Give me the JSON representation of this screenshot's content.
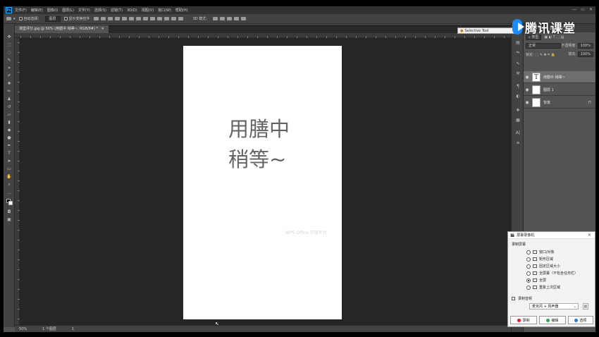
{
  "menubar": {
    "logo": "Ps",
    "items": [
      "文件(F)",
      "编辑(E)",
      "图像(I)",
      "图层(L)",
      "文字(Y)",
      "选择(S)",
      "滤镜(T)",
      "3D(D)",
      "视图(V)",
      "窗口(W)",
      "帮助(H)"
    ],
    "controls": [
      "—",
      "▭",
      "✕"
    ]
  },
  "optbar": {
    "auto_select": "自动选择：",
    "auto_select_value": "图层",
    "show_transform": "显示变换控件",
    "mode_3d": "3D 模式："
  },
  "document": {
    "tab_title": "课堂评分.jpg @ 50% (用膳中 稍等~, RGB/8#) *",
    "text_line1": "用膳中",
    "text_line2": "稍等~",
    "watermark": "WPS Office 开放平台"
  },
  "statusbar": {
    "zoom": "50%",
    "info": "1 个图层",
    "extra": "1"
  },
  "selective_tool": {
    "label": "Selective Tool"
  },
  "tencent": {
    "brand": "腾讯课堂"
  },
  "layers_panel": {
    "tabs": [
      "图层",
      "通道",
      "路径",
      "历史记录"
    ],
    "filter_label": "类型",
    "blend_mode": "正常",
    "opacity_label": "不透明度:",
    "opacity_value": "100%",
    "lock_label": "锁定:",
    "fill_label": "填充:",
    "fill_value": "100%",
    "layers": [
      {
        "name": "用膳中 稍等~",
        "thumb": "T"
      },
      {
        "name": "图层 1",
        "thumb": ""
      },
      {
        "name": "背景",
        "thumb": ""
      }
    ]
  },
  "recorder": {
    "title": "屏幕录像机",
    "section_screen": "录制屏幕",
    "options": [
      "窗口/对象",
      "矩形区域",
      "固定区域大小",
      "全屏幕（不包含任务栏）",
      "全屏",
      "重复上次区域"
    ],
    "section_audio": "录制音频",
    "audio_value": "麦克风 + 扬声器",
    "btn_record": "录制",
    "btn_edit": "编辑",
    "btn_options": "选项"
  },
  "colors": {
    "ps_bg": "#535353",
    "canvas_bg": "#262626",
    "accent": "#1a8cff",
    "record_red": "#e02020",
    "edit_green": "#2aa84a",
    "options_blue": "#2a7ad8"
  }
}
